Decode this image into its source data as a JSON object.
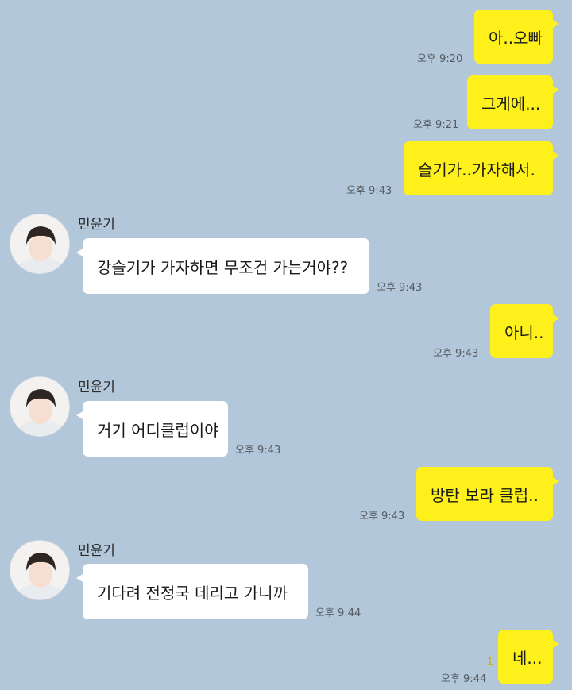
{
  "chat": {
    "contact_name": "민윤기",
    "messages": [
      {
        "from": "me",
        "text": "아..오빠",
        "time": "오후 9:20"
      },
      {
        "from": "me",
        "text": "그게에...",
        "time": "오후 9:21"
      },
      {
        "from": "me",
        "text": "슬기가..가자해서.",
        "time": "오후 9:43"
      },
      {
        "from": "them",
        "sender": "민윤기",
        "text": "강슬기가 가자하면 무조건 가는거야??",
        "time": "오후 9:43"
      },
      {
        "from": "me",
        "text": "아니..",
        "time": "오후 9:43"
      },
      {
        "from": "them",
        "sender": "민윤기",
        "text": "거기 어디클럽이야",
        "time": "오후 9:43"
      },
      {
        "from": "me",
        "text": "방탄 보라 클럽..",
        "time": "오후 9:43"
      },
      {
        "from": "them",
        "sender": "민윤기",
        "text": "기다려 전정국 데리고 가니까",
        "time": "오후 9:44"
      },
      {
        "from": "me",
        "text": "네...",
        "time": "오후 9:44",
        "unread": "1"
      }
    ]
  },
  "colors": {
    "background": "#b2c7d9",
    "my_bubble": "#fef01b",
    "their_bubble": "#ffffff"
  }
}
